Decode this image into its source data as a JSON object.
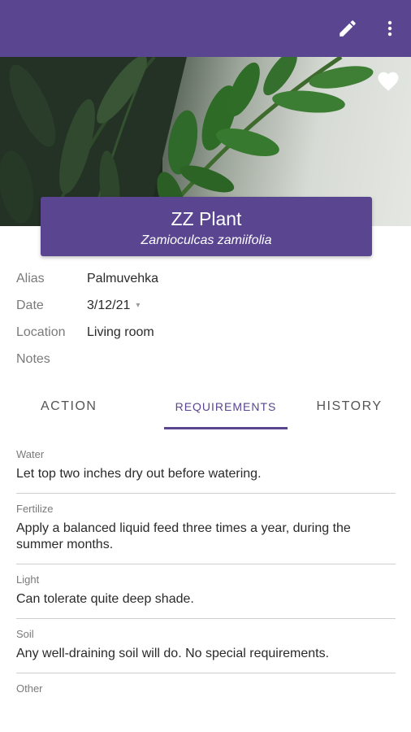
{
  "toolbar": {
    "edit_icon": "pencil-icon",
    "more_icon": "more-vert-icon",
    "color": "#5a4590"
  },
  "hero": {
    "favorite_icon": "heart-icon"
  },
  "plant": {
    "name": "ZZ Plant",
    "scientific_name": "Zamioculcas zamiifolia"
  },
  "details": {
    "alias_label": "Alias",
    "alias_value": "Palmuvehka",
    "date_label": "Date",
    "date_value": "3/12/21",
    "location_label": "Location",
    "location_value": "Living room",
    "notes_label": "Notes",
    "notes_value": ""
  },
  "tabs": [
    {
      "label": "ACTION",
      "active": false
    },
    {
      "label": "REQUIREMENTS",
      "active": true
    },
    {
      "label": "HISTORY",
      "active": false
    }
  ],
  "requirements": [
    {
      "label": "Water",
      "text": "Let top two inches dry out before watering."
    },
    {
      "label": "Fertilize",
      "text": "Apply a balanced liquid feed three times a year, during the summer months."
    },
    {
      "label": "Light",
      "text": "Can tolerate quite deep shade."
    },
    {
      "label": "Soil",
      "text": "Any well-draining soil will do. No special requirements."
    },
    {
      "label": "Other",
      "text": ""
    }
  ]
}
